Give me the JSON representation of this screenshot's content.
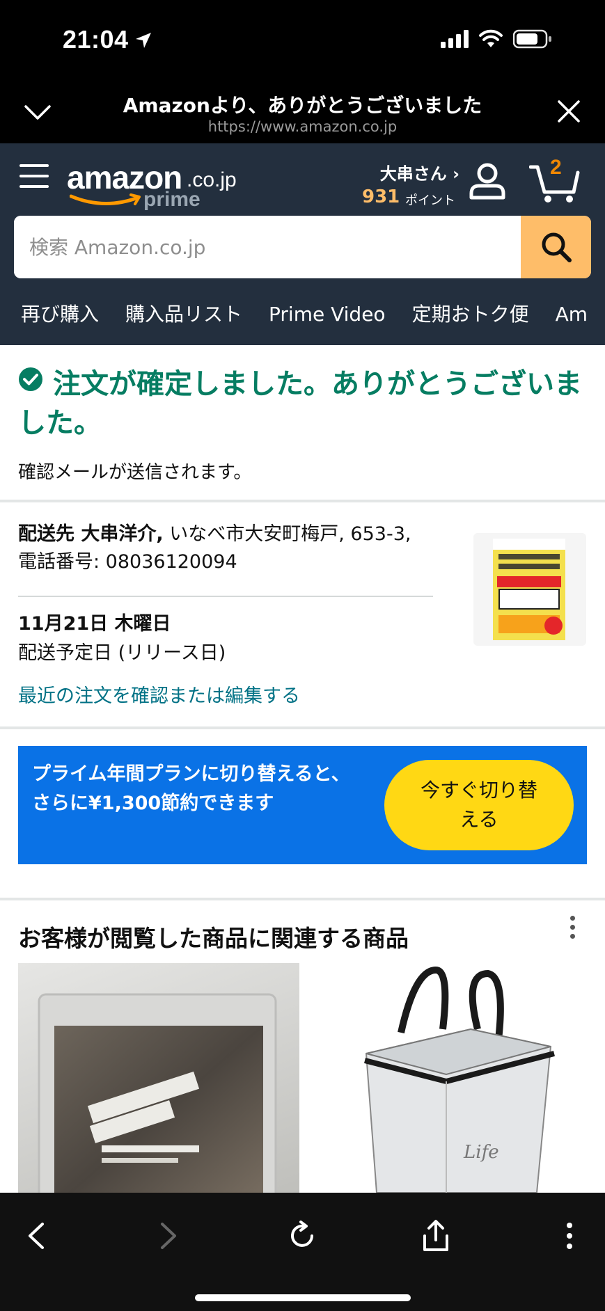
{
  "status": {
    "time": "21:04"
  },
  "browser": {
    "title": "Amazonより、ありがとうございました",
    "url": "https://www.amazon.co.jp"
  },
  "header": {
    "logo": {
      "word": "amazon",
      "tld": ".co.jp",
      "sub": "prime"
    },
    "account_name": "大串さん ›",
    "points": "931",
    "points_label": "ポイント",
    "cart_count": "2",
    "search_placeholder": "検索 Amazon.co.jp",
    "nav": [
      "再び購入",
      "購入品リスト",
      "Prime Video",
      "定期おトク便",
      "Am"
    ]
  },
  "confirm": {
    "title": "注文が確定しました。ありがとうございました。",
    "subtitle": "確認メールが送信されます。"
  },
  "delivery": {
    "label": "配送先 大串洋介,",
    "address": "いなべ市大安町梅戸, 653-3, 電話番号: 08036120094",
    "date": "11月21日 木曜日",
    "date_note": "配送予定日 (リリース日)",
    "edit_link": "最近の注文を確認または編集する"
  },
  "promo": {
    "text": "プライム年間プランに切り替えると、さらに¥1,300節約できます",
    "button": "今すぐ切り替える"
  },
  "related": {
    "title": "お客様が閲覧した商品に関連する商品"
  },
  "colors": {
    "header_bg": "#232f3e",
    "search_button": "#febd69",
    "success_green": "#067d62",
    "link_teal": "#007185",
    "promo_blue": "#0a72e6",
    "promo_button": "#ffd814",
    "points_orange": "#febd69"
  }
}
